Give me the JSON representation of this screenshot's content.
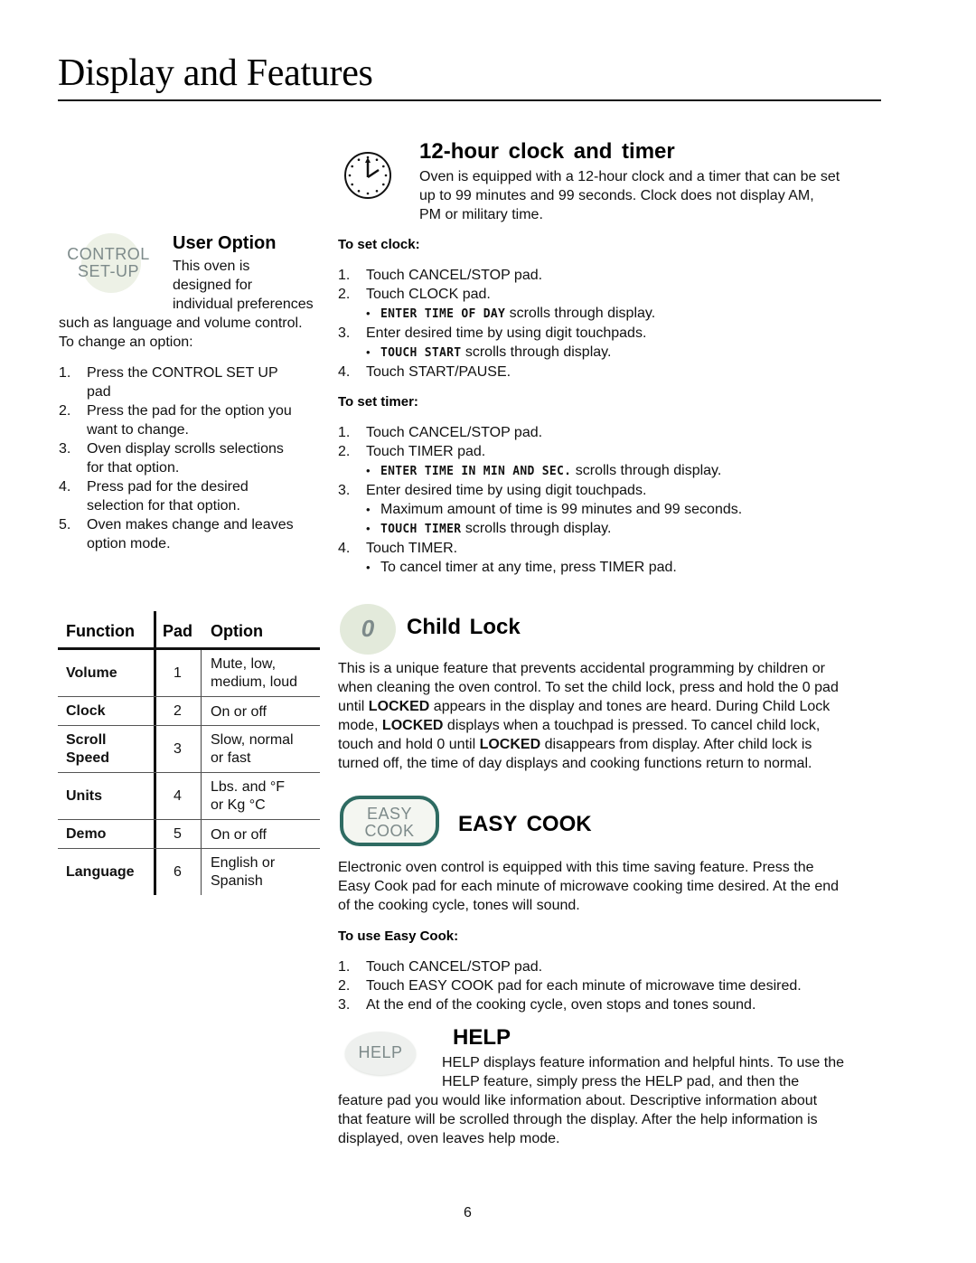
{
  "page": {
    "title": "Display and Features",
    "page_number": "6"
  },
  "user_option": {
    "icon_label_line1": "CONTROL",
    "icon_label_line2": "SET-UP",
    "heading": "User Option",
    "intro_lines": [
      "This oven is",
      "designed for",
      "individual preferences",
      "such as language and volume control.",
      "To change an option:"
    ],
    "steps": [
      {
        "num": "1.",
        "lines": [
          "Press the CONTROL SET UP",
          "pad"
        ]
      },
      {
        "num": "2.",
        "lines": [
          "Press the pad for the option you",
          "want to change."
        ]
      },
      {
        "num": "3.",
        "lines": [
          "Oven display scrolls selections",
          "for that option."
        ]
      },
      {
        "num": "4.",
        "lines": [
          "Press pad for the desired",
          "selection for that option."
        ]
      },
      {
        "num": "5.",
        "lines": [
          "Oven makes change and leaves",
          "option mode."
        ]
      }
    ]
  },
  "options_table": {
    "headers": [
      "Function",
      "Pad",
      "Option"
    ],
    "rows": [
      {
        "function": [
          "Volume"
        ],
        "pad": "1",
        "option": [
          "Mute, low,",
          "medium, loud"
        ]
      },
      {
        "function": [
          "Clock"
        ],
        "pad": "2",
        "option": [
          "On or off"
        ]
      },
      {
        "function": [
          "Scroll",
          "Speed"
        ],
        "pad": "3",
        "option": [
          "Slow, normal",
          "or fast"
        ]
      },
      {
        "function": [
          "Units"
        ],
        "pad": "4",
        "option": [
          "Lbs. and °F",
          "or Kg °C"
        ]
      },
      {
        "function": [
          "Demo"
        ],
        "pad": "5",
        "option": [
          "On or off"
        ]
      },
      {
        "function": [
          "Language"
        ],
        "pad": "6",
        "option": [
          "English or",
          "Spanish"
        ]
      }
    ]
  },
  "clock_timer": {
    "icon": "clock-icon",
    "heading": "12-hour clock and timer",
    "intro_lines": [
      "Oven is equipped with a 12-hour clock and a timer that can be set",
      "up to 99 minutes and 99 seconds. Clock does not display AM,",
      "PM or military time."
    ],
    "set_clock": {
      "heading": "To set clock:",
      "step1": "Touch CANCEL/STOP pad.",
      "step2": "Touch CLOCK pad.",
      "step2_bullet_lcd": "ENTER TIME OF DAY",
      "step2_bullet_rest": " scrolls through display.",
      "step3": "Enter desired time by using digit touchpads.",
      "step3_bullet_lcd": "TOUCH START",
      "step3_bullet_rest": " scrolls through display.",
      "step4": "Touch START/PAUSE."
    },
    "set_timer": {
      "heading": "To set timer:",
      "step1": "Touch CANCEL/STOP pad.",
      "step2": "Touch TIMER pad.",
      "step2_bullet_lcd": "ENTER TIME IN MIN AND SEC.",
      "step2_bullet_rest": " scrolls through display.",
      "step3": "Enter desired time by using digit touchpads.",
      "step3_bullet1": "Maximum amount of time is 99 minutes and 99 seconds.",
      "step3_bullet2_lcd": "TOUCH TIMER",
      "step3_bullet2_rest": " scrolls through display.",
      "step4": "Touch TIMER.",
      "step4_bullet": "To cancel timer at any time, press TIMER pad."
    }
  },
  "child_lock": {
    "icon_label": "0",
    "heading": "Child Lock",
    "p1": "This is a unique feature that prevents accidental programming by children or",
    "p2": "when cleaning the oven control. To set the child lock, press and hold the 0 pad",
    "p3a": "until ",
    "locked": "LOCKED",
    "p3b": " appears in the display and tones are heard. During Child Lock",
    "p4a": "mode, ",
    "p4b": " displays when a touchpad is pressed. To cancel child lock,",
    "p5a": "touch and hold 0 until ",
    "p5b": " disappears from display. After child lock is",
    "p6": "turned off, the time of day displays and cooking functions return to normal."
  },
  "easy_cook": {
    "icon_label_line1": "EASY",
    "icon_label_line2": "COOK",
    "heading": "EASY COOK",
    "intro_lines": [
      "Electronic oven control is equipped with this time saving feature. Press the",
      "Easy Cook pad for each minute of microwave cooking time desired. At the end",
      "of the cooking cycle, tones will sound."
    ],
    "subheading": "To use Easy Cook:",
    "steps": [
      {
        "num": "1.",
        "text": "Touch CANCEL/STOP pad."
      },
      {
        "num": "2.",
        "text": "Touch EASY COOK pad for each minute of microwave time desired."
      },
      {
        "num": "3.",
        "text": "At the end of the cooking cycle, oven stops and tones sound."
      }
    ]
  },
  "help": {
    "icon_label": "HELP",
    "heading": "HELP",
    "lines": [
      "HELP displays feature information and helpful hints. To use the",
      "HELP feature, simply press the HELP pad, and then the",
      "feature pad you would like information about. Descriptive information about",
      "that feature will be scrolled through the display. After the help information is",
      "displayed, oven leaves help mode."
    ]
  },
  "colors": {
    "icon_text": "#7d8a8a",
    "icon_circle": "#e3eadb",
    "easy_cook_border": "#2e6b62",
    "help_oval": "#eef0ee"
  }
}
